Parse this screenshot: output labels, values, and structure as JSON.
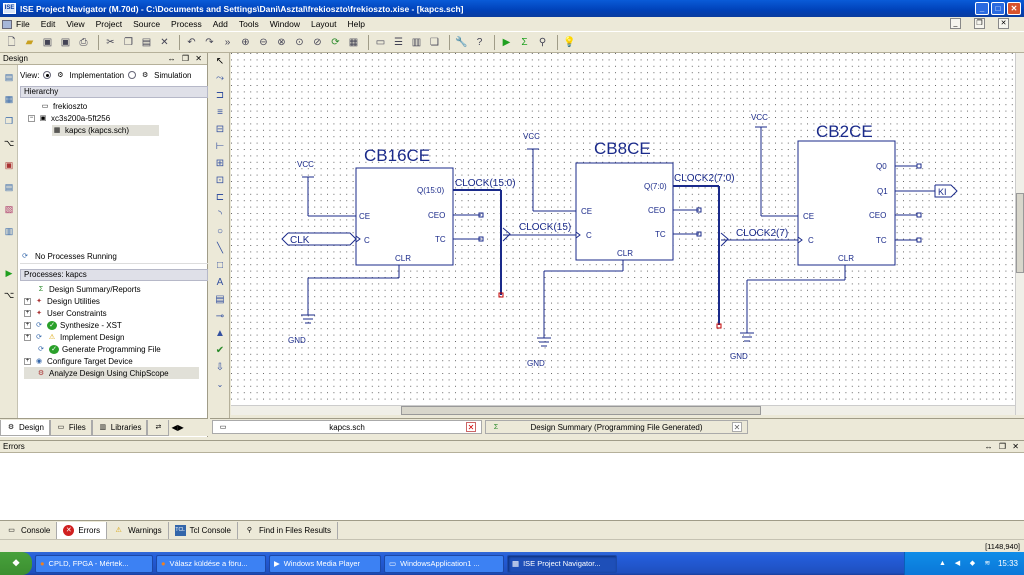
{
  "window": {
    "title": "ISE Project Navigator (M.70d) - C:\\Documents and Settings\\Dani\\Asztal\\frekioszto\\frekioszto.xise - [kapcs.sch]",
    "app_icon": "ise-app-icon",
    "controls": [
      "minimize-icon",
      "maximize-icon",
      "close-icon"
    ]
  },
  "menu": [
    "File",
    "Edit",
    "View",
    "Project",
    "Source",
    "Process",
    "Add",
    "Tools",
    "Window",
    "Layout",
    "Help"
  ],
  "toolbar": {
    "icons": [
      "new-icon",
      "open-icon",
      "save-icon",
      "save-all-icon",
      "print-icon",
      "cut-icon",
      "copy-icon",
      "paste-icon",
      "delete-icon",
      "undo-icon",
      "redo-icon",
      "more-icon",
      "zoom-in-icon",
      "zoom-out-icon",
      "zoom-full-icon",
      "zoom-selection-icon",
      "zoom-to-box-icon",
      "refresh-icon",
      "ascii-icon",
      "window-icon",
      "tile-horizontal-icon",
      "tile-vertical-icon",
      "cascade-icon",
      "wrench-icon",
      "help-query-icon",
      "run-icon",
      "sigma-icon",
      "probe-icon",
      "bulb-icon"
    ]
  },
  "design_panel": {
    "title": "Design",
    "view_label": "View:",
    "view_options": [
      {
        "label": "Implementation",
        "selected": true
      },
      {
        "label": "Simulation",
        "selected": false
      }
    ],
    "hierarchy_title": "Hierarchy",
    "hierarchy": [
      {
        "label": "frekioszto",
        "level": 0,
        "icon": "project-icon"
      },
      {
        "label": "xc3s200a-5ft256",
        "level": 1,
        "icon": "chip-icon"
      },
      {
        "label": "kapcs (kapcs.sch)",
        "level": 2,
        "icon": "schematic-icon",
        "selected": true
      }
    ],
    "no_processes": "No Processes Running",
    "processes_title": "Processes: kapcs",
    "processes": [
      {
        "label": "Design Summary/Reports",
        "expander": false,
        "icon": "sigma-icon"
      },
      {
        "label": "Design Utilities",
        "expander": true,
        "icon": "tools-icon"
      },
      {
        "label": "User Constraints",
        "expander": true,
        "icon": "constraints-icon"
      },
      {
        "label": "Synthesize - XST",
        "expander": true,
        "icon": "check-icon"
      },
      {
        "label": "Implement Design",
        "expander": true,
        "icon": "warning-icon"
      },
      {
        "label": "Generate Programming File",
        "expander": false,
        "icon": "check-icon"
      },
      {
        "label": "Configure Target Device",
        "expander": true,
        "icon": "target-icon"
      },
      {
        "label": "Analyze Design Using ChipScope",
        "expander": false,
        "icon": "chipscope-icon",
        "selected": true
      }
    ],
    "tabs": [
      "Design",
      "Files",
      "Libraries"
    ]
  },
  "schematic": {
    "components": [
      {
        "name": "CB16CE",
        "pins_left": [
          "CE",
          "C"
        ],
        "pins_right": [
          "Q(15:0)",
          "CEO",
          "TC"
        ],
        "pin_bottom": "CLR",
        "vcc": "VCC",
        "gnd": "GND"
      },
      {
        "name": "CB8CE",
        "pins_left": [
          "CE",
          "C"
        ],
        "pins_right": [
          "Q(7:0)",
          "CEO",
          "TC"
        ],
        "pin_bottom": "CLR",
        "vcc": "VCC",
        "gnd": "GND"
      },
      {
        "name": "CB2CE",
        "pins_left": [
          "CE",
          "C"
        ],
        "pins_right": [
          "Q0",
          "Q1",
          "CEO",
          "TC"
        ],
        "pin_bottom": "CLR",
        "vcc": "VCC",
        "gnd": "GND"
      }
    ],
    "input_port": "CLK",
    "output_port": "KI",
    "nets": [
      "CLOCK(15:0)",
      "CLOCK(15)",
      "CLOCK2(7:0)",
      "CLOCK2(7)"
    ]
  },
  "doc_tabs": [
    {
      "label": "kapcs.sch",
      "active": true
    },
    {
      "label": "Design Summary (Programming File Generated)",
      "active": false
    }
  ],
  "errors_panel": {
    "title": "Errors"
  },
  "console_tabs": [
    "Console",
    "Errors",
    "Warnings",
    "Tcl Console",
    "Find in Files Results"
  ],
  "statusbar": {
    "coords": "[1148,940]"
  },
  "taskbar": {
    "start": "start",
    "tasks": [
      "CPLD, FPGA - Mértek...",
      "Válasz küldése a föru...",
      "Windows Media Player",
      "WindowsApplication1 ...",
      "ISE Project Navigator..."
    ],
    "clock": "15:33"
  },
  "colors": {
    "title": "#0a3c9e",
    "schematic": "#1a2a8a",
    "net": "#000080",
    "taskbar": "#245edb"
  }
}
